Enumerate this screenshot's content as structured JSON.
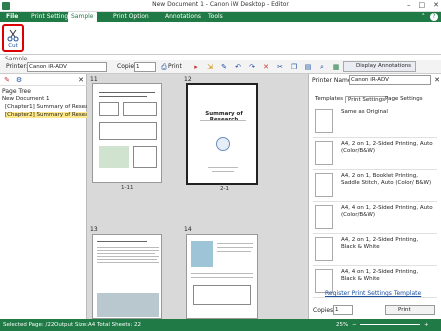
{
  "window": {
    "title": "New Document 1 - Canon iW Desktop - Editor"
  },
  "menu_tabs": [
    "File",
    "Print Settings",
    "Sample",
    "Print Option",
    "Annotations",
    "Tools"
  ],
  "ribbon": {
    "cut_label": "Cut",
    "group_label": "Sample"
  },
  "toolbar": {
    "printer_label": "Printer:",
    "printer_value": "Canon iR-ADV",
    "copies_label": "Copies:",
    "copies_value": "1",
    "print_label": "Print",
    "display_annotations_label": "Display Annotations"
  },
  "left_pane": {
    "page_tree_label": "Page Tree",
    "items": [
      "New Document 1",
      "[Chapter1] Summary of Resear",
      "[Chapter2] Summary of Resear"
    ]
  },
  "pages": [
    {
      "num": "11",
      "caption": "1-11"
    },
    {
      "num": "12",
      "caption": "2-1",
      "heading": "Summary of Research"
    },
    {
      "num": "13",
      "caption": ""
    },
    {
      "num": "14",
      "caption": ""
    }
  ],
  "right_pane": {
    "printer_name_label": "Printer Name:",
    "printer_name_value": "Canon iR-ADV",
    "tabs": [
      "Templates",
      "Print Settings",
      "Page Settings"
    ],
    "templates": [
      "Same as Original",
      "A4, 2 on 1, 2-Sided Printing, Auto (Color/B&W)",
      "A4, 2 on 1, Booklet Printing, Saddle Stitch, Auto (Color/ B&W)",
      "A4, 4 on 1, 2-Sided Printing, Auto (Color/B&W)",
      "A4, 2 on 1, 2-Sided Printing, Black & White",
      "A4, 4 on 1, 2-Sided Printing, Black & White"
    ],
    "register_link": "Register Print Settings Template",
    "copies_label": "Copies:",
    "copies_value": "1",
    "print_button": "Print"
  },
  "status": {
    "selected_page": "Selected Page: /22",
    "output_size": "Output Size:A4",
    "total_sheets": "Total Sheets: 22",
    "zoom": "25%"
  },
  "colors": {
    "accent": "#1f7a45",
    "highlight": "#ffe88a",
    "cut_border": "#dd0000"
  }
}
